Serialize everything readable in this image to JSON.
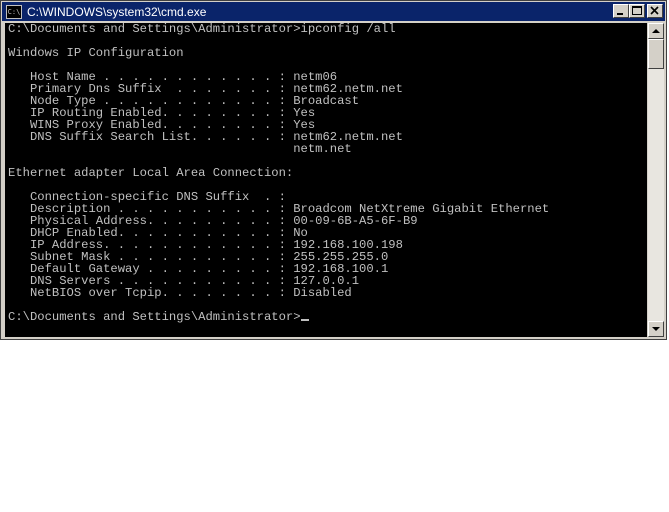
{
  "window": {
    "title": "C:\\WINDOWS\\system32\\cmd.exe",
    "icon_text": "C:\\",
    "icons": {
      "app": "console-app-icon",
      "minimize": "minimize-icon",
      "maximize": "maximize-icon",
      "close": "close-icon",
      "scroll_up": "scroll-up-arrow-icon",
      "scroll_down": "scroll-down-arrow-icon"
    }
  },
  "console": {
    "lines": [
      "C:\\Documents and Settings\\Administrator>ipconfig /all",
      "",
      "Windows IP Configuration",
      "",
      "   Host Name . . . . . . . . . . . . : netm06",
      "   Primary Dns Suffix  . . . . . . . : netm62.netm.net",
      "   Node Type . . . . . . . . . . . . : Broadcast",
      "   IP Routing Enabled. . . . . . . . : Yes",
      "   WINS Proxy Enabled. . . . . . . . : Yes",
      "   DNS Suffix Search List. . . . . . : netm62.netm.net",
      "                                       netm.net",
      "",
      "Ethernet adapter Local Area Connection:",
      "",
      "   Connection-specific DNS Suffix  . :",
      "   Description . . . . . . . . . . . : Broadcom NetXtreme Gigabit Ethernet",
      "   Physical Address. . . . . . . . . : 00-09-6B-A5-6F-B9",
      "   DHCP Enabled. . . . . . . . . . . : No",
      "   IP Address. . . . . . . . . . . . : 192.168.100.198",
      "   Subnet Mask . . . . . . . . . . . : 255.255.255.0",
      "   Default Gateway . . . . . . . . . : 192.168.100.1",
      "   DNS Servers . . . . . . . . . . . : 127.0.0.1",
      "   NetBIOS over Tcpip. . . . . . . . : Disabled",
      ""
    ],
    "prompt": "C:\\Documents and Settings\\Administrator>"
  },
  "colors": {
    "titlebar": "#0a246a",
    "console_bg": "#000000",
    "console_fg": "#c0c0c0",
    "chrome": "#d4d0c8"
  }
}
